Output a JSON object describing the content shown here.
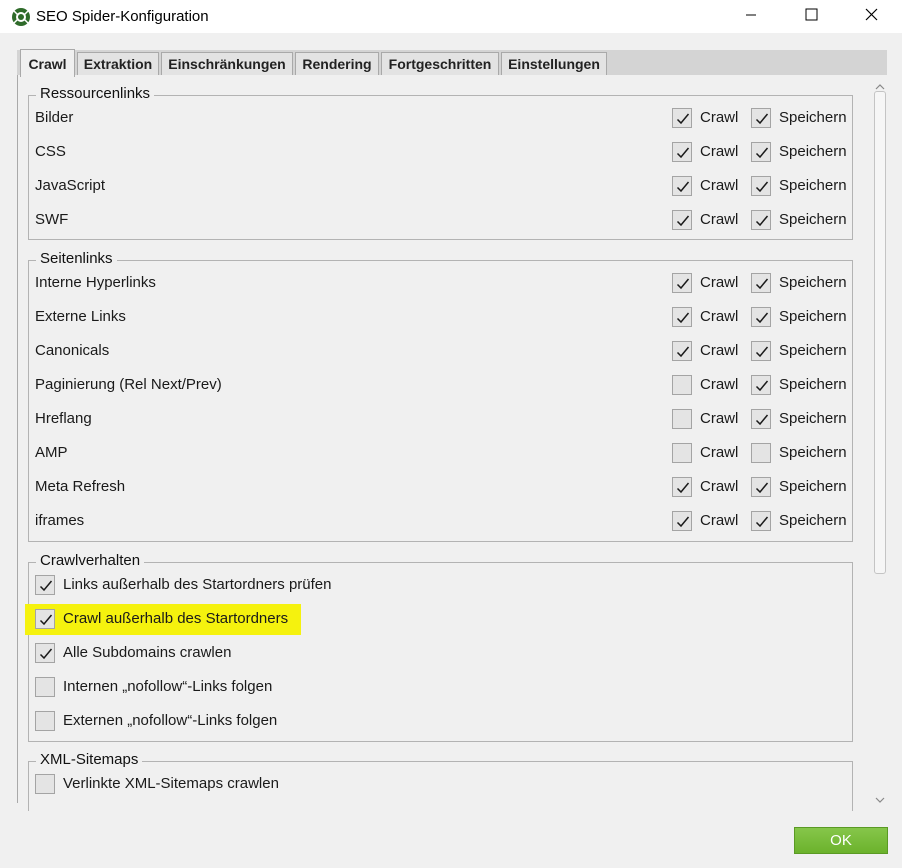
{
  "window": {
    "title": "SEO Spider-Konfiguration"
  },
  "tabs": [
    "Crawl",
    "Extraktion",
    "Einschränkungen",
    "Rendering",
    "Fortgeschritten",
    "Einstellungen"
  ],
  "active_tab": "Crawl",
  "col_labels": {
    "crawl": "Crawl",
    "store": "Speichern"
  },
  "resource_links": {
    "legend": "Ressourcenlinks",
    "rows": [
      {
        "label": "Bilder",
        "crawl": true,
        "store": true
      },
      {
        "label": "CSS",
        "crawl": true,
        "store": true
      },
      {
        "label": "JavaScript",
        "crawl": true,
        "store": true
      },
      {
        "label": "SWF",
        "crawl": true,
        "store": true
      }
    ]
  },
  "page_links": {
    "legend": "Seitenlinks",
    "rows": [
      {
        "label": "Interne Hyperlinks",
        "crawl": true,
        "store": true
      },
      {
        "label": "Externe Links",
        "crawl": true,
        "store": true
      },
      {
        "label": "Canonicals",
        "crawl": true,
        "store": true
      },
      {
        "label": "Paginierung (Rel Next/Prev)",
        "crawl": false,
        "store": true
      },
      {
        "label": "Hreflang",
        "crawl": false,
        "store": true
      },
      {
        "label": "AMP",
        "crawl": false,
        "store": false
      },
      {
        "label": "Meta Refresh",
        "crawl": true,
        "store": true
      },
      {
        "label": "iframes",
        "crawl": true,
        "store": true
      }
    ]
  },
  "crawl_behavior": {
    "legend": "Crawlverhalten",
    "options": [
      {
        "label": "Links außerhalb des Startordners prüfen",
        "checked": true
      },
      {
        "label": "Crawl außerhalb des Startordners",
        "checked": true,
        "highlighted": true
      },
      {
        "label": "Alle Subdomains crawlen",
        "checked": true
      },
      {
        "label": "Internen „nofollow“-Links folgen",
        "checked": false
      },
      {
        "label": "Externen „nofollow“-Links folgen",
        "checked": false
      }
    ]
  },
  "xml_sitemaps": {
    "legend": "XML-Sitemaps",
    "options": [
      {
        "label": "Verlinkte XML-Sitemaps crawlen",
        "checked": false
      }
    ]
  },
  "ok_button": "OK",
  "colors": {
    "highlight": "#f5f20e",
    "ok_button": "#76bb38"
  },
  "icons": {
    "app": "spider-logo-icon",
    "minimize": "minimize-icon",
    "maximize": "maximize-icon",
    "close": "close-icon",
    "check": "checkmark-icon"
  }
}
